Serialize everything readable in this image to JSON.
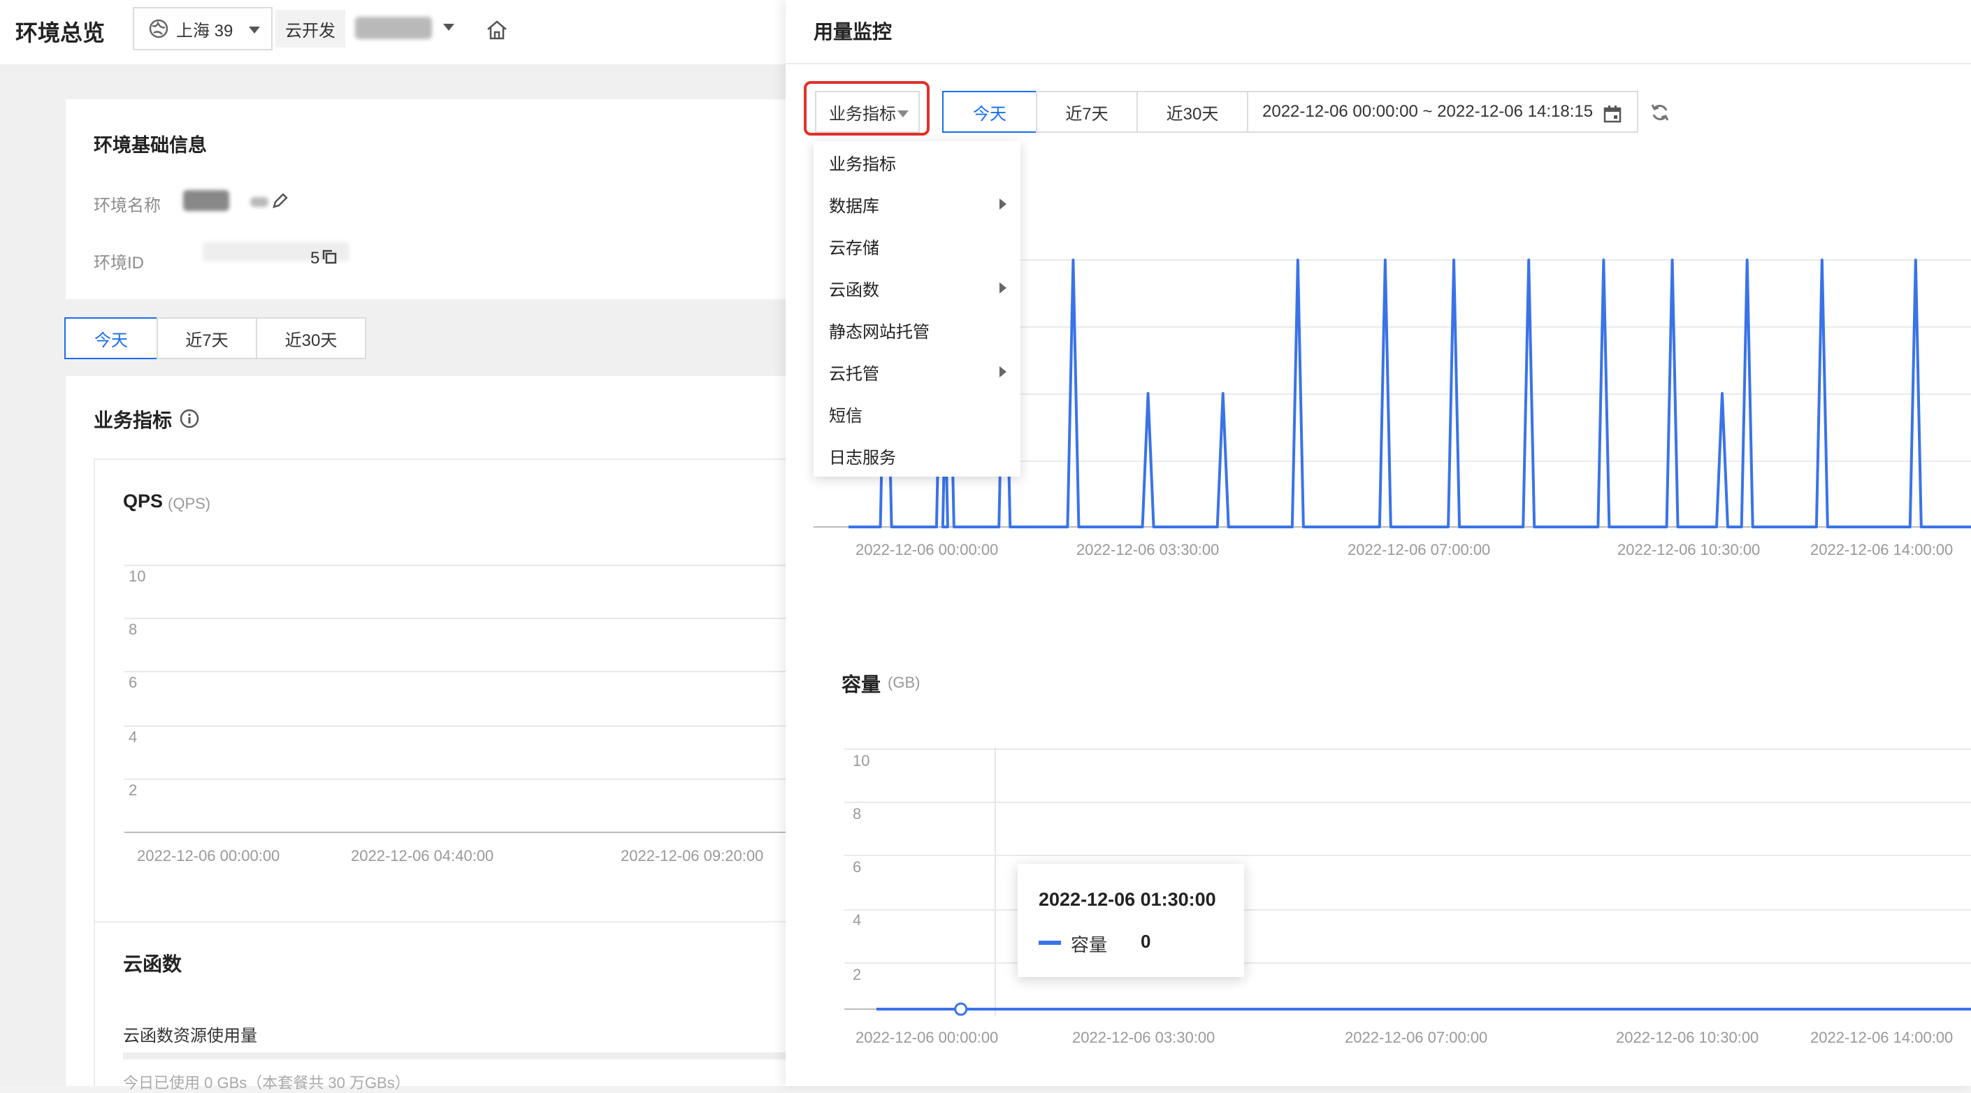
{
  "header": {
    "title": "环境总览",
    "region": "上海 39",
    "env_tag": "云开发"
  },
  "basic_info": {
    "title": "环境基础信息",
    "env_name_label": "环境名称",
    "env_id_label": "环境ID",
    "env_id_suffix": "5"
  },
  "left_ranges": [
    "今天",
    "近7天",
    "近30天"
  ],
  "biz_section": {
    "title": "业务指标",
    "qps_title": "QPS",
    "qps_unit": "(QPS)",
    "y_ticks": [
      "10",
      "8",
      "6",
      "4",
      "2"
    ],
    "x_ticks": [
      "2022-12-06 00:00:00",
      "2022-12-06 04:40:00",
      "2022-12-06 09:20:00"
    ]
  },
  "cloud_fn": {
    "title": "云函数",
    "resource_label": "云函数资源使用量",
    "usage_text": "今日已使用 0 GBs（本套餐共 30 万GBs）"
  },
  "monitor": {
    "title": "用量监控",
    "metric_select": "业务指标",
    "ranges": [
      "今天",
      "近7天",
      "近30天"
    ],
    "date_range": "2022-12-06 00:00:00 ~ 2022-12-06 14:18:15"
  },
  "dropdown": {
    "items": [
      {
        "label": "业务指标",
        "has_sub": false
      },
      {
        "label": "数据库",
        "has_sub": true
      },
      {
        "label": "云存储",
        "has_sub": false
      },
      {
        "label": "云函数",
        "has_sub": true
      },
      {
        "label": "静态网站托管",
        "has_sub": false
      },
      {
        "label": "云托管",
        "has_sub": true
      },
      {
        "label": "短信",
        "has_sub": false
      },
      {
        "label": "日志服务",
        "has_sub": false
      }
    ]
  },
  "colors": {
    "accent": "#1a6cf0",
    "line": "#3a73e8",
    "highlight_border": "#e0322b"
  },
  "chart_data": [
    {
      "type": "line",
      "title": "",
      "x_ticks": [
        "2022-12-06 00:00:00",
        "2022-12-06 03:30:00",
        "2022-12-06 07:00:00",
        "2022-12-06 10:30:00",
        "2022-12-06 14:00:00"
      ],
      "ylim": [
        0,
        1
      ],
      "series": [
        {
          "x": [
            "00:30",
            "01:15",
            "01:20",
            "02:05",
            "03:00",
            "04:00",
            "05:00",
            "06:00",
            "07:10",
            "08:05",
            "09:05",
            "10:05",
            "11:00",
            "11:40",
            "12:00",
            "13:00",
            "14:15"
          ],
          "values": [
            1,
            1,
            1,
            1,
            1,
            0.5,
            0.5,
            1,
            1,
            1,
            1,
            1,
            1,
            0.5,
            1,
            1,
            1
          ]
        }
      ]
    },
    {
      "type": "line",
      "title": "容量",
      "unit": "(GB)",
      "ylim": [
        0,
        10
      ],
      "y_ticks": [
        "10",
        "8",
        "6",
        "4",
        "2"
      ],
      "x_ticks": [
        "2022-12-06 00:00:00",
        "2022-12-06 03:30:00",
        "2022-12-06 07:00:00",
        "2022-12-06 10:30:00",
        "2022-12-06 14:00:00"
      ],
      "series": [
        {
          "name": "容量",
          "x": [
            "00:00",
            "14:18"
          ],
          "values": [
            0,
            0
          ]
        }
      ],
      "tooltip": {
        "time": "2022-12-06 01:30:00",
        "series": "容量",
        "value": "0"
      }
    }
  ]
}
